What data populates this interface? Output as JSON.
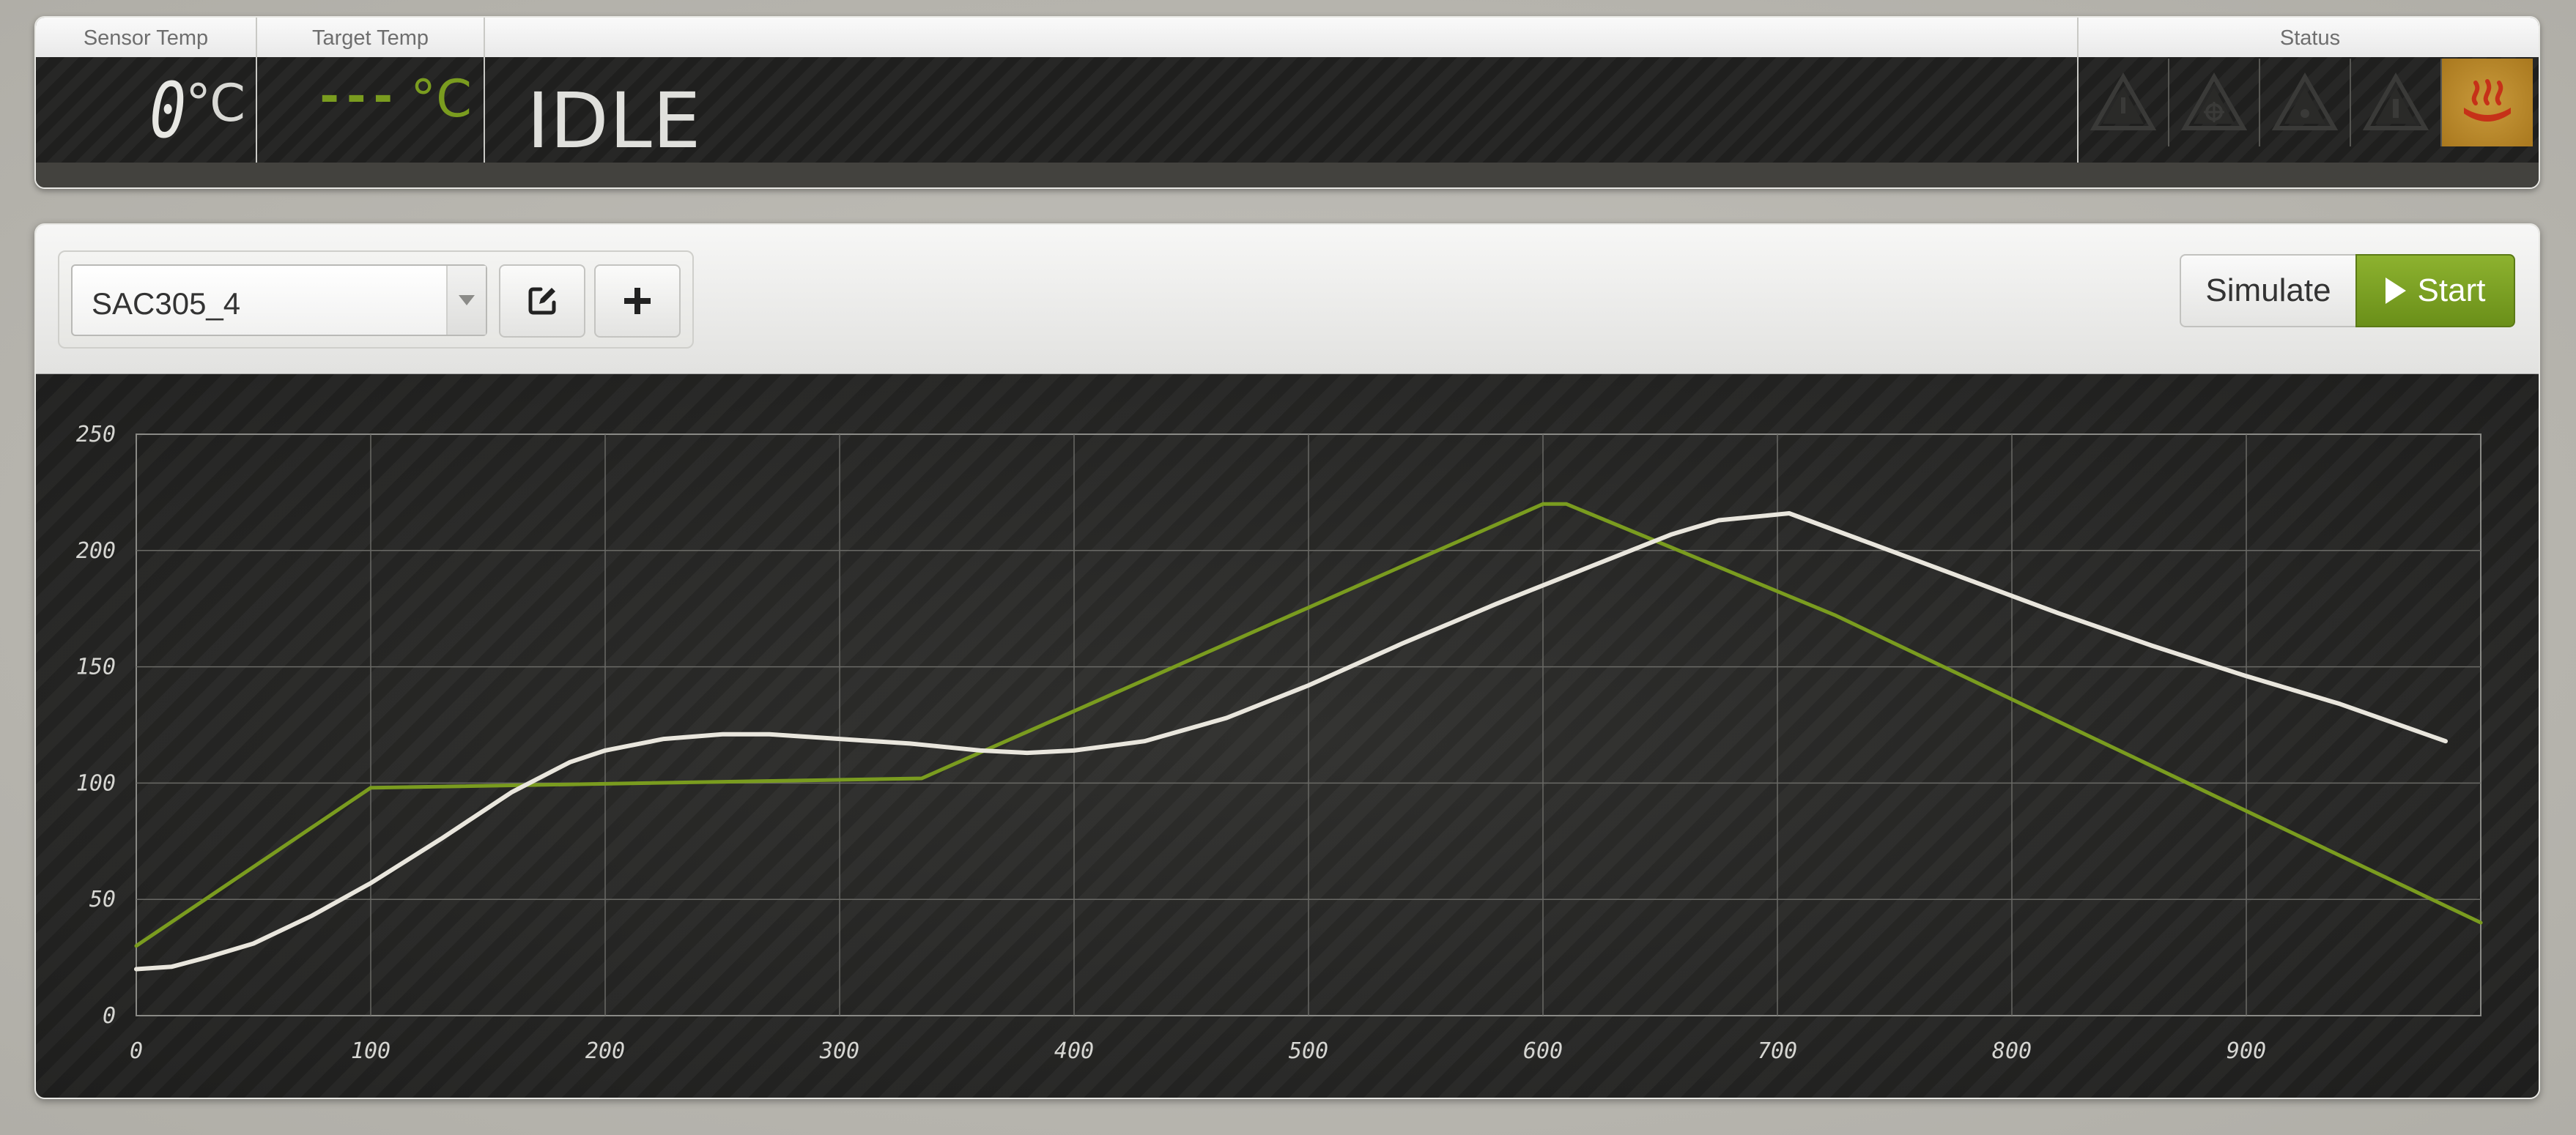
{
  "status_panel": {
    "sensor_label": "Sensor Temp",
    "sensor_value": "0",
    "sensor_unit": "°C",
    "target_label": "Target Temp",
    "target_value": "---",
    "target_unit": "°C",
    "state": "IDLE",
    "status_label": "Status",
    "status_icons": [
      {
        "name": "warning-icon",
        "active": false
      },
      {
        "name": "fan-icon",
        "active": false
      },
      {
        "name": "alert-icon",
        "active": false
      },
      {
        "name": "door-icon",
        "active": false
      },
      {
        "name": "heater-icon",
        "active": true
      }
    ]
  },
  "toolbar": {
    "profile_selected": "SAC305_4",
    "edit_icon": "edit-icon",
    "add_icon": "plus-icon",
    "simulate_label": "Simulate",
    "start_label": "Start"
  },
  "colors": {
    "target_line": "#7a9c1f",
    "sensor_line": "#e9e6dd",
    "start_button": "#7ba124",
    "heater_active": "#c18b2f"
  },
  "chart_data": {
    "type": "line",
    "xlim": [
      0,
      1000
    ],
    "ylim": [
      0,
      250
    ],
    "x_ticks": [
      0,
      100,
      200,
      300,
      400,
      500,
      600,
      700,
      800,
      900
    ],
    "y_ticks": [
      0,
      50,
      100,
      150,
      200,
      250
    ],
    "grid": true,
    "series": [
      {
        "color": "#7a9c1f",
        "points": [
          [
            0,
            30
          ],
          [
            100,
            98
          ],
          [
            335,
            102
          ],
          [
            600,
            220
          ],
          [
            610,
            220
          ],
          [
            725,
            172
          ],
          [
            1000,
            40
          ]
        ]
      },
      {
        "color": "#e9e6dd",
        "points": [
          [
            0,
            20
          ],
          [
            15,
            21
          ],
          [
            30,
            25
          ],
          [
            50,
            31
          ],
          [
            75,
            43
          ],
          [
            100,
            57
          ],
          [
            130,
            76
          ],
          [
            160,
            96
          ],
          [
            185,
            109
          ],
          [
            200,
            114
          ],
          [
            225,
            119
          ],
          [
            250,
            121
          ],
          [
            270,
            121
          ],
          [
            300,
            119
          ],
          [
            330,
            117
          ],
          [
            360,
            114
          ],
          [
            380,
            113
          ],
          [
            400,
            114
          ],
          [
            430,
            118
          ],
          [
            465,
            128
          ],
          [
            500,
            142
          ],
          [
            540,
            160
          ],
          [
            580,
            177
          ],
          [
            620,
            193
          ],
          [
            655,
            207
          ],
          [
            675,
            213
          ],
          [
            695,
            215
          ],
          [
            705,
            216
          ],
          [
            740,
            203
          ],
          [
            780,
            188
          ],
          [
            820,
            173
          ],
          [
            860,
            159
          ],
          [
            900,
            146
          ],
          [
            940,
            134
          ],
          [
            985,
            118
          ]
        ]
      }
    ]
  }
}
